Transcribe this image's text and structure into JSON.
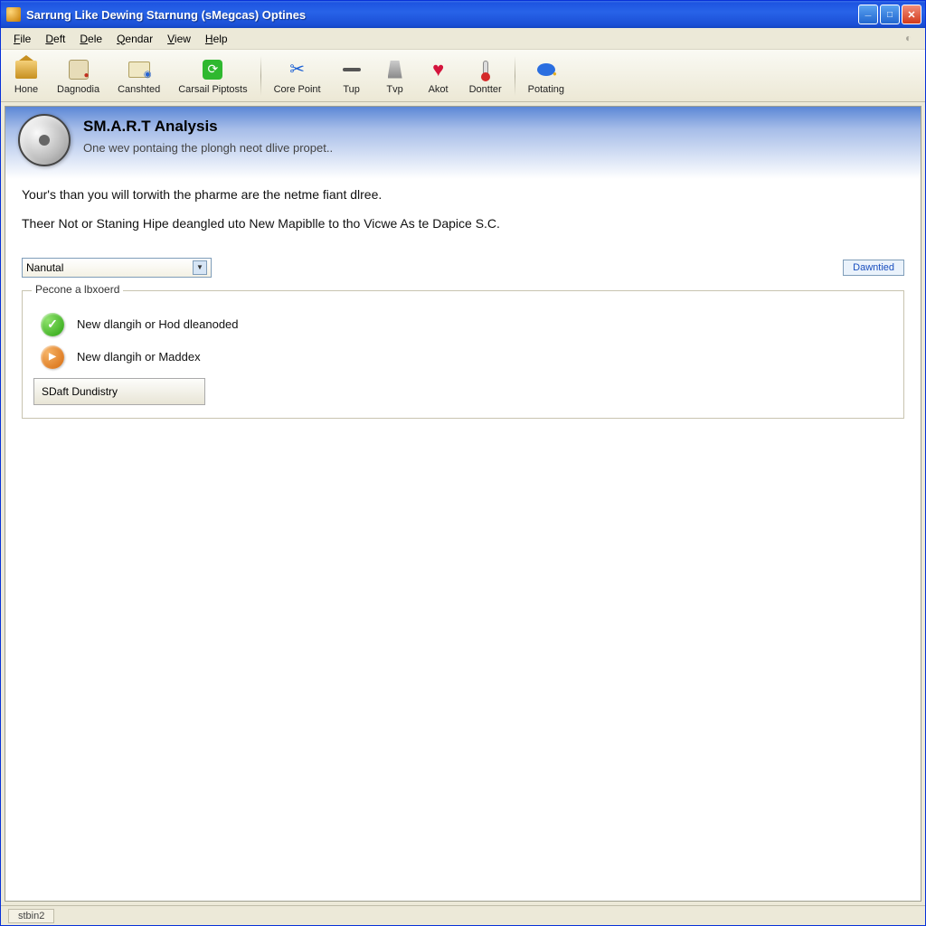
{
  "titlebar": {
    "text": "Sarrung Like Dewing Starnung (sMegcas) Optines"
  },
  "menu": {
    "items": [
      "File",
      "Deft",
      "Dele",
      "Qendar",
      "View",
      "Help"
    ]
  },
  "toolbar": {
    "items": [
      {
        "label": "Hone"
      },
      {
        "label": "Dagnodia"
      },
      {
        "label": "Canshted"
      },
      {
        "label": "Carsail Piptosts"
      }
    ],
    "items2": [
      {
        "label": "Core Point"
      },
      {
        "label": "Tup"
      },
      {
        "label": "Tvp"
      },
      {
        "label": "Akot"
      },
      {
        "label": "Dontter"
      }
    ],
    "items3": [
      {
        "label": "Potating"
      }
    ]
  },
  "header": {
    "title": "SM.A.R.T Analysis",
    "subtitle": "One wev pontaing the plongh neot dlive propet.."
  },
  "body": {
    "p1": "Your's than you will torwith the pharme are the netme fiant dlree.",
    "p2": "Theer Not or Staning Hipe deangled uto New Mapiblle to tho Vicwe As te Dapice S.C."
  },
  "combo": {
    "selected": "Nanutal"
  },
  "right_link": "Dawntied",
  "fieldset": {
    "legend": "Pecone a lbxoerd",
    "items": [
      {
        "status": "ok",
        "text": "New dlangih or Hod dleanoded"
      },
      {
        "status": "warn",
        "text": "New dlangih or Maddex"
      }
    ],
    "action": "SDaft Dundistry"
  },
  "statusbar": {
    "left": "stbin2"
  }
}
